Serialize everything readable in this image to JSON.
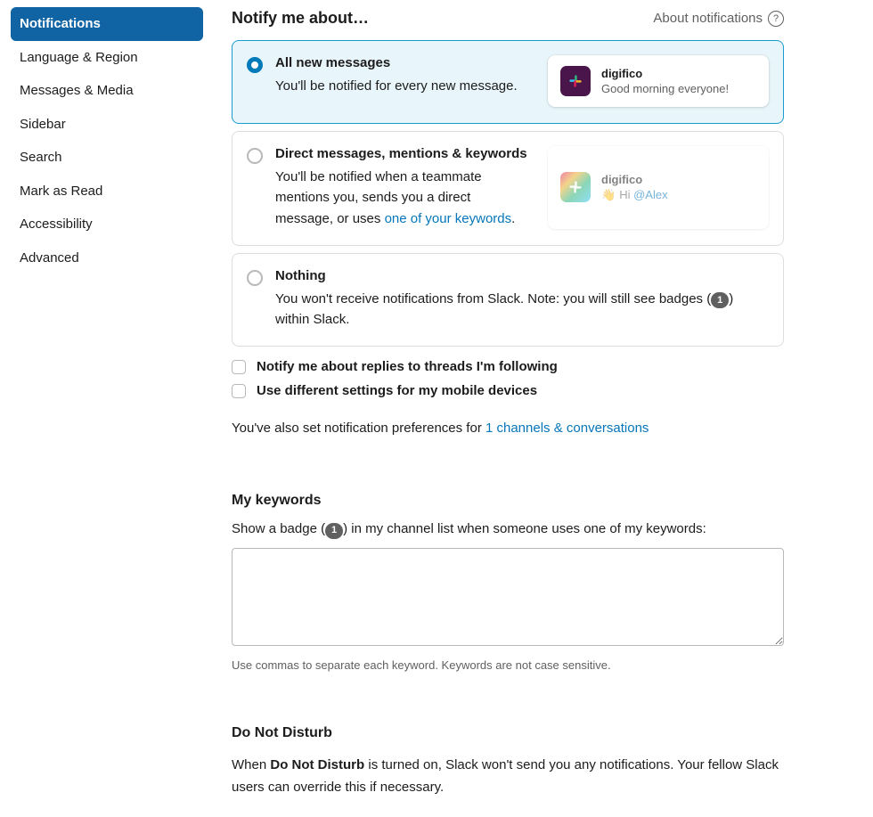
{
  "sidebar": {
    "items": [
      {
        "label": "Notifications",
        "selected": true
      },
      {
        "label": "Language & Region",
        "selected": false
      },
      {
        "label": "Messages & Media",
        "selected": false
      },
      {
        "label": "Sidebar",
        "selected": false
      },
      {
        "label": "Search",
        "selected": false
      },
      {
        "label": "Mark as Read",
        "selected": false
      },
      {
        "label": "Accessibility",
        "selected": false
      },
      {
        "label": "Advanced",
        "selected": false
      }
    ]
  },
  "header": {
    "title": "Notify me about…",
    "about_link": "About notifications"
  },
  "options": {
    "all": {
      "title": "All new messages",
      "desc": "You'll be notified for every new message.",
      "selected": true,
      "preview": {
        "name": "digifico",
        "msg": "Good morning everyone!"
      }
    },
    "dm": {
      "title": "Direct messages, mentions & keywords",
      "desc_pre": "You'll be notified when a teammate mentions you, sends you a direct message, or uses ",
      "desc_link": "one of your keywords",
      "desc_post": ".",
      "selected": false,
      "preview": {
        "name": "digifico",
        "msg_prefix": "Hi ",
        "mention": "@Alex"
      }
    },
    "nothing": {
      "title": "Nothing",
      "desc_pre": "You won't receive notifications from Slack. Note: you will still see badges (",
      "badge": "1",
      "desc_post": ") within Slack.",
      "selected": false
    }
  },
  "checkboxes": {
    "threads": "Notify me about replies to threads I'm following",
    "mobile": "Use different settings for my mobile devices"
  },
  "also_set": {
    "pre": "You've also set notification preferences for ",
    "link": "1 channels & conversations"
  },
  "keywords": {
    "title": "My keywords",
    "desc_pre": "Show a badge (",
    "badge": "1",
    "desc_post": ") in my channel list when someone uses one of my keywords:",
    "value": "",
    "hint": "Use commas to separate each keyword. Keywords are not case sensitive."
  },
  "dnd": {
    "title": "Do Not Disturb",
    "pre": "When ",
    "bold": "Do Not Disturb",
    "post": " is turned on, Slack won't send you any notifications. Your fellow Slack users can override this if necessary."
  }
}
